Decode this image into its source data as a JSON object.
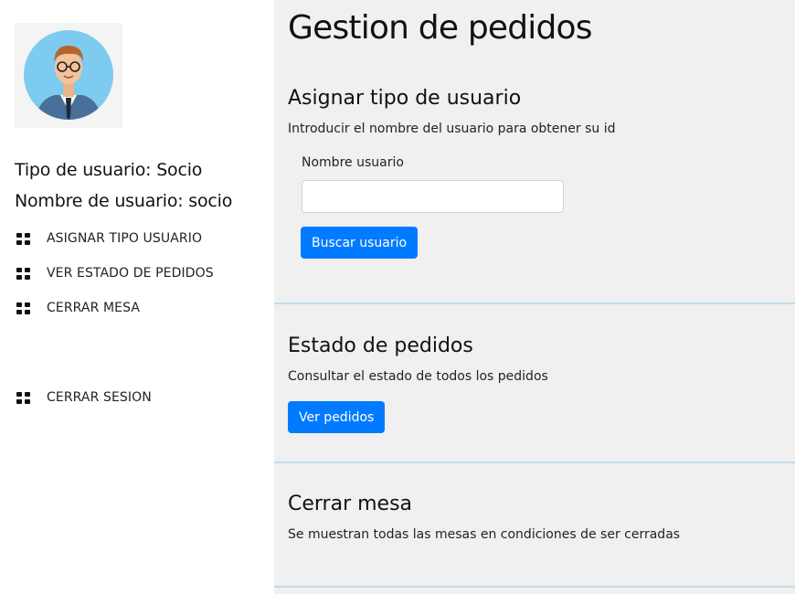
{
  "sidebar": {
    "avatar_icon": "user-avatar-icon",
    "user_type_line": "Tipo de usuario: Socio",
    "user_name_line": "Nombre de usuario: socio",
    "nav": [
      {
        "label": "ASIGNAR TIPO USUARIO",
        "icon": "grid-icon"
      },
      {
        "label": "VER ESTADO DE PEDIDOS",
        "icon": "grid-icon"
      },
      {
        "label": "CERRAR MESA",
        "icon": "grid-icon"
      },
      {
        "label": "CERRAR SESION",
        "icon": "grid-icon"
      }
    ]
  },
  "main": {
    "title": "Gestion de pedidos",
    "sections": {
      "asignar": {
        "title": "Asignar tipo de usuario",
        "desc": "Introducir el nombre del usuario para obtener su id",
        "field_label": "Nombre usuario",
        "field_value": "",
        "button": "Buscar usuario"
      },
      "estado": {
        "title": "Estado de pedidos",
        "desc": "Consultar el estado de todos los pedidos",
        "button": "Ver pedidos"
      },
      "cerrar": {
        "title": "Cerrar mesa",
        "desc": "Se muestran todas las mesas en condiciones de ser cerradas"
      }
    }
  },
  "colors": {
    "primary": "#007bff",
    "main_bg": "#f0f0f0",
    "divider": "#c2dbea"
  }
}
